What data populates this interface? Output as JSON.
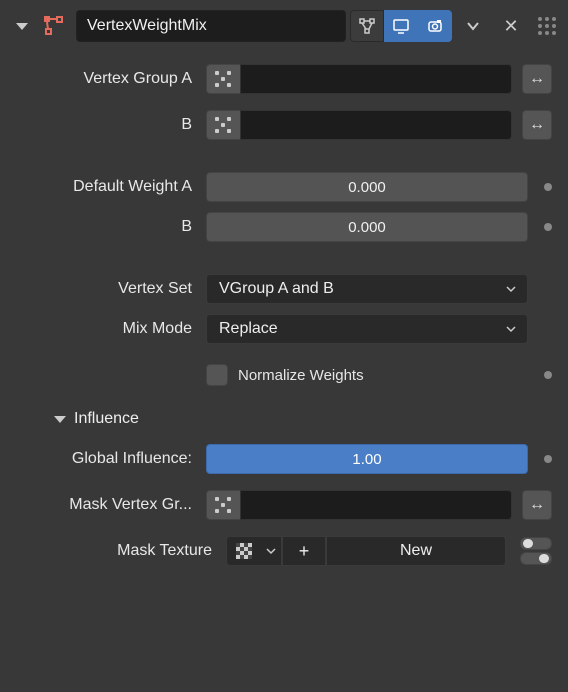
{
  "header": {
    "modifier_name": "VertexWeightMix"
  },
  "fields": {
    "vertex_group_a_label": "Vertex Group A",
    "vertex_group_b_label": "B",
    "default_weight_a_label": "Default Weight A",
    "default_weight_a_value": "0.000",
    "default_weight_b_label": "B",
    "default_weight_b_value": "0.000",
    "vertex_set_label": "Vertex Set",
    "vertex_set_value": "VGroup A and B",
    "mix_mode_label": "Mix Mode",
    "mix_mode_value": "Replace",
    "normalize_label": "Normalize Weights"
  },
  "influence": {
    "section_label": "Influence",
    "global_label": "Global Influence:",
    "global_value": "1.00",
    "mask_vg_label": "Mask Vertex Gr...",
    "mask_tex_label": "Mask Texture",
    "new_label": "New",
    "plus_label": "+"
  }
}
